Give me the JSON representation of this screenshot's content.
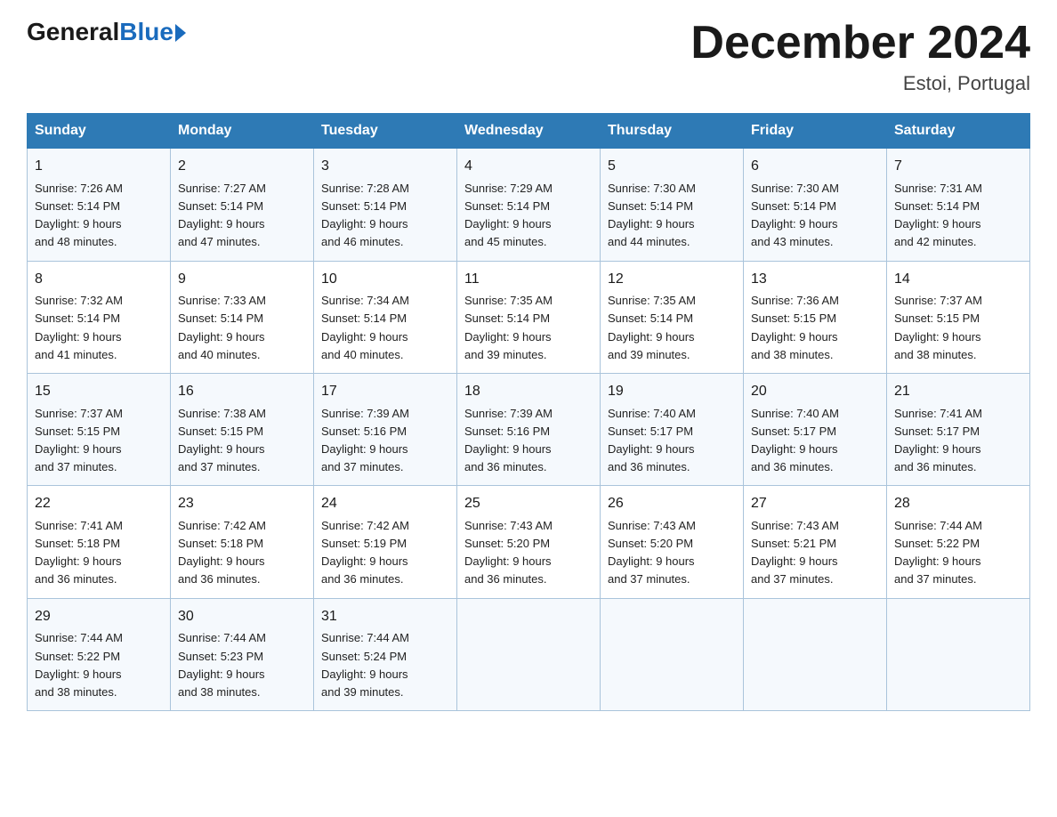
{
  "header": {
    "logo_general": "General",
    "logo_blue": "Blue",
    "title": "December 2024",
    "subtitle": "Estoi, Portugal"
  },
  "weekdays": [
    "Sunday",
    "Monday",
    "Tuesday",
    "Wednesday",
    "Thursday",
    "Friday",
    "Saturday"
  ],
  "weeks": [
    [
      {
        "num": "1",
        "sunrise": "7:26 AM",
        "sunset": "5:14 PM",
        "daylight": "9 hours and 48 minutes."
      },
      {
        "num": "2",
        "sunrise": "7:27 AM",
        "sunset": "5:14 PM",
        "daylight": "9 hours and 47 minutes."
      },
      {
        "num": "3",
        "sunrise": "7:28 AM",
        "sunset": "5:14 PM",
        "daylight": "9 hours and 46 minutes."
      },
      {
        "num": "4",
        "sunrise": "7:29 AM",
        "sunset": "5:14 PM",
        "daylight": "9 hours and 45 minutes."
      },
      {
        "num": "5",
        "sunrise": "7:30 AM",
        "sunset": "5:14 PM",
        "daylight": "9 hours and 44 minutes."
      },
      {
        "num": "6",
        "sunrise": "7:30 AM",
        "sunset": "5:14 PM",
        "daylight": "9 hours and 43 minutes."
      },
      {
        "num": "7",
        "sunrise": "7:31 AM",
        "sunset": "5:14 PM",
        "daylight": "9 hours and 42 minutes."
      }
    ],
    [
      {
        "num": "8",
        "sunrise": "7:32 AM",
        "sunset": "5:14 PM",
        "daylight": "9 hours and 41 minutes."
      },
      {
        "num": "9",
        "sunrise": "7:33 AM",
        "sunset": "5:14 PM",
        "daylight": "9 hours and 40 minutes."
      },
      {
        "num": "10",
        "sunrise": "7:34 AM",
        "sunset": "5:14 PM",
        "daylight": "9 hours and 40 minutes."
      },
      {
        "num": "11",
        "sunrise": "7:35 AM",
        "sunset": "5:14 PM",
        "daylight": "9 hours and 39 minutes."
      },
      {
        "num": "12",
        "sunrise": "7:35 AM",
        "sunset": "5:14 PM",
        "daylight": "9 hours and 39 minutes."
      },
      {
        "num": "13",
        "sunrise": "7:36 AM",
        "sunset": "5:15 PM",
        "daylight": "9 hours and 38 minutes."
      },
      {
        "num": "14",
        "sunrise": "7:37 AM",
        "sunset": "5:15 PM",
        "daylight": "9 hours and 38 minutes."
      }
    ],
    [
      {
        "num": "15",
        "sunrise": "7:37 AM",
        "sunset": "5:15 PM",
        "daylight": "9 hours and 37 minutes."
      },
      {
        "num": "16",
        "sunrise": "7:38 AM",
        "sunset": "5:15 PM",
        "daylight": "9 hours and 37 minutes."
      },
      {
        "num": "17",
        "sunrise": "7:39 AM",
        "sunset": "5:16 PM",
        "daylight": "9 hours and 37 minutes."
      },
      {
        "num": "18",
        "sunrise": "7:39 AM",
        "sunset": "5:16 PM",
        "daylight": "9 hours and 36 minutes."
      },
      {
        "num": "19",
        "sunrise": "7:40 AM",
        "sunset": "5:17 PM",
        "daylight": "9 hours and 36 minutes."
      },
      {
        "num": "20",
        "sunrise": "7:40 AM",
        "sunset": "5:17 PM",
        "daylight": "9 hours and 36 minutes."
      },
      {
        "num": "21",
        "sunrise": "7:41 AM",
        "sunset": "5:17 PM",
        "daylight": "9 hours and 36 minutes."
      }
    ],
    [
      {
        "num": "22",
        "sunrise": "7:41 AM",
        "sunset": "5:18 PM",
        "daylight": "9 hours and 36 minutes."
      },
      {
        "num": "23",
        "sunrise": "7:42 AM",
        "sunset": "5:18 PM",
        "daylight": "9 hours and 36 minutes."
      },
      {
        "num": "24",
        "sunrise": "7:42 AM",
        "sunset": "5:19 PM",
        "daylight": "9 hours and 36 minutes."
      },
      {
        "num": "25",
        "sunrise": "7:43 AM",
        "sunset": "5:20 PM",
        "daylight": "9 hours and 36 minutes."
      },
      {
        "num": "26",
        "sunrise": "7:43 AM",
        "sunset": "5:20 PM",
        "daylight": "9 hours and 37 minutes."
      },
      {
        "num": "27",
        "sunrise": "7:43 AM",
        "sunset": "5:21 PM",
        "daylight": "9 hours and 37 minutes."
      },
      {
        "num": "28",
        "sunrise": "7:44 AM",
        "sunset": "5:22 PM",
        "daylight": "9 hours and 37 minutes."
      }
    ],
    [
      {
        "num": "29",
        "sunrise": "7:44 AM",
        "sunset": "5:22 PM",
        "daylight": "9 hours and 38 minutes."
      },
      {
        "num": "30",
        "sunrise": "7:44 AM",
        "sunset": "5:23 PM",
        "daylight": "9 hours and 38 minutes."
      },
      {
        "num": "31",
        "sunrise": "7:44 AM",
        "sunset": "5:24 PM",
        "daylight": "9 hours and 39 minutes."
      },
      null,
      null,
      null,
      null
    ]
  ],
  "labels": {
    "sunrise": "Sunrise: ",
    "sunset": "Sunset: ",
    "daylight": "Daylight: "
  }
}
